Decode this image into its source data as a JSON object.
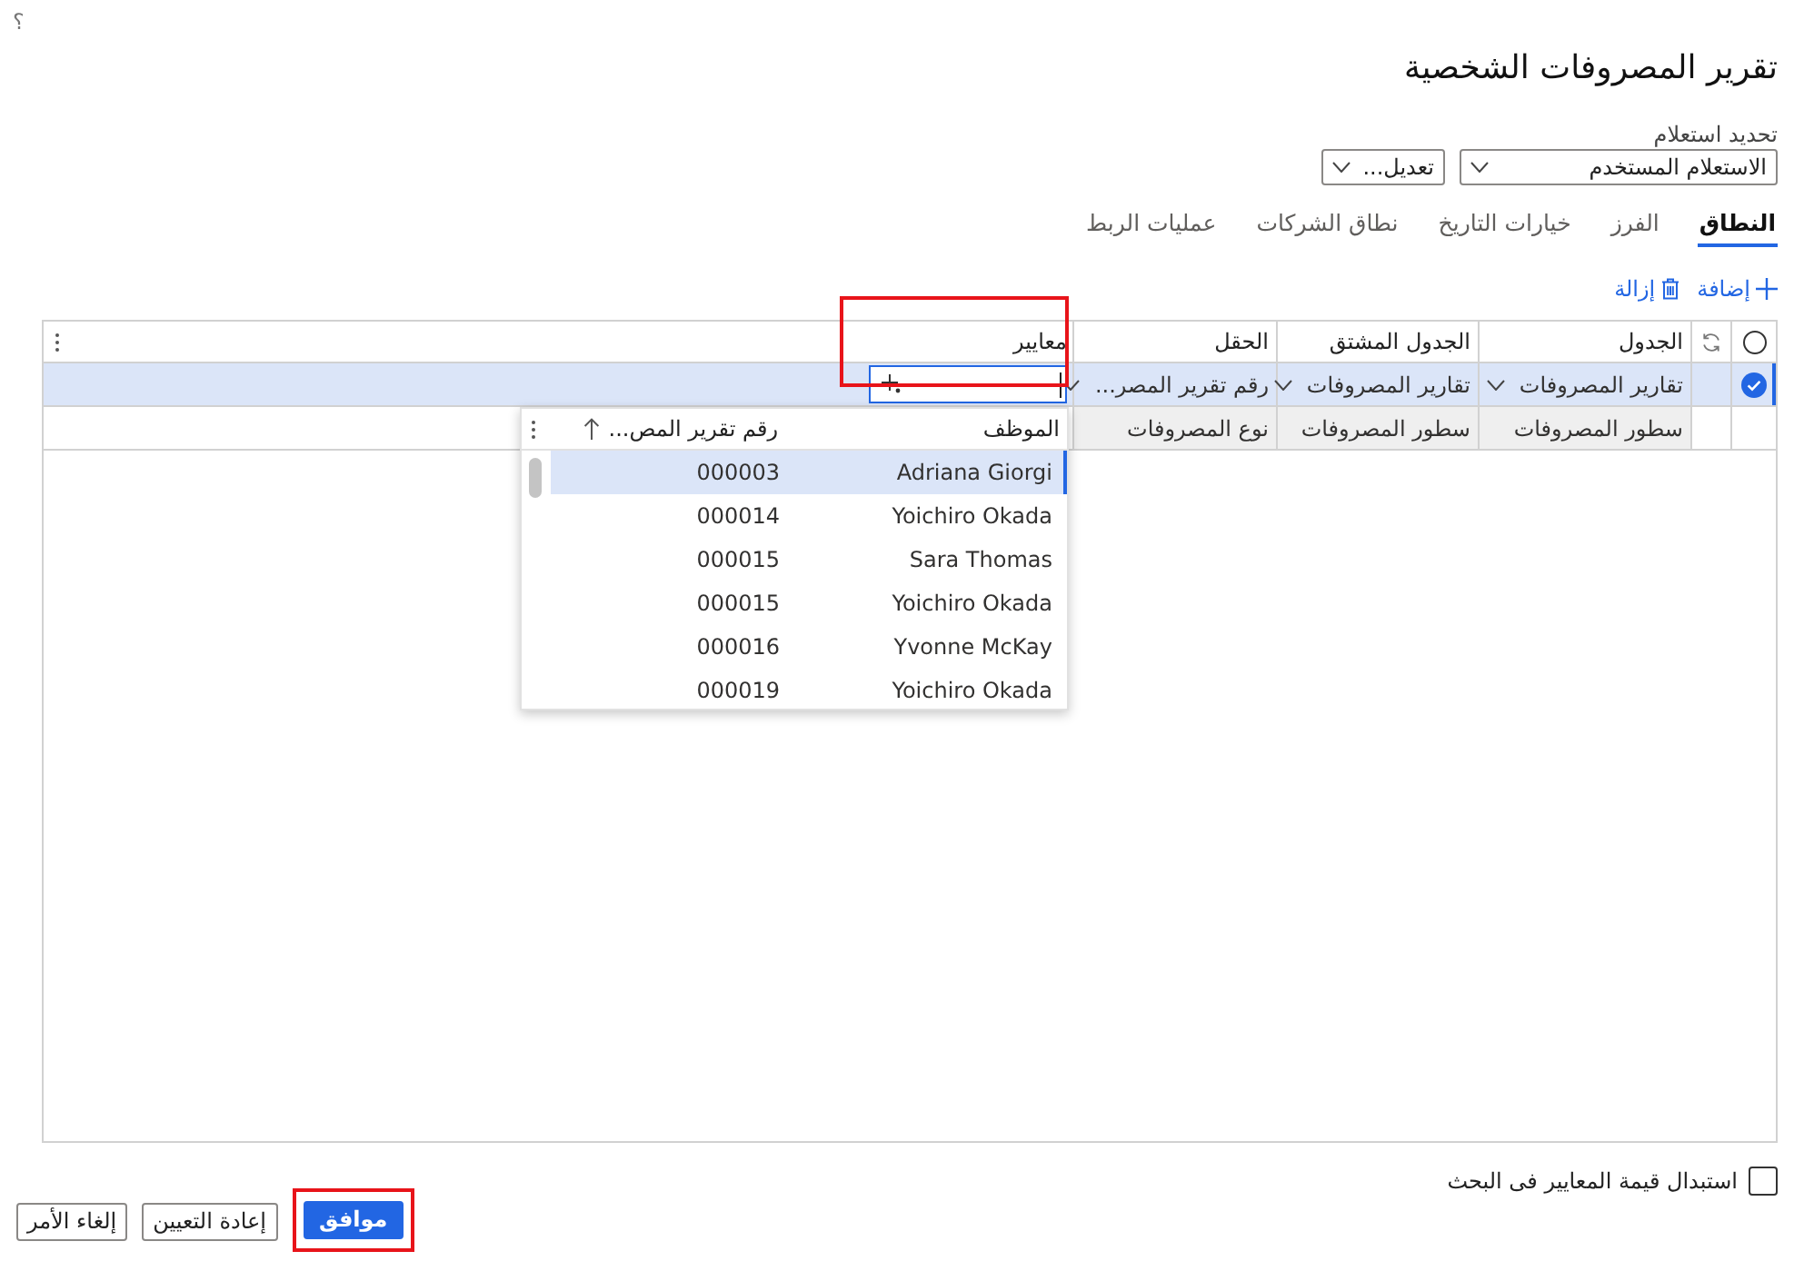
{
  "help": {
    "glyph": "؟"
  },
  "page_title": "تقرير المصروفات الشخصية",
  "query": {
    "label": "تحديد استعلام",
    "value": "الاستعلام المستخدم",
    "modify_button": "تعديل..."
  },
  "tabs": [
    {
      "label": "النطاق",
      "selected": true
    },
    {
      "label": "الفرز",
      "selected": false
    },
    {
      "label": "خيارات التاريخ",
      "selected": false
    },
    {
      "label": "نطاق الشركات",
      "selected": false
    },
    {
      "label": "عمليات الربط",
      "selected": false
    }
  ],
  "toolbar": {
    "add": "إضافة",
    "remove": "إزالة"
  },
  "grid": {
    "select_all_checked": false,
    "criteria_highlighted": true,
    "columns": [
      "الجدول",
      "الجدول المشتق",
      "الحقل",
      "معايير"
    ],
    "rows": [
      {
        "selected": true,
        "readonly": false,
        "cells": [
          "تقارير المصروفات",
          "تقارير المصروفات",
          "رقم تقرير المصر..."
        ]
      },
      {
        "selected": false,
        "readonly": true,
        "cells": [
          "سطور المصروفات",
          "سطور المصروفات",
          "نوع المصروفات"
        ]
      }
    ]
  },
  "lookup": {
    "columns": [
      "الموظف",
      "رقم تقرير المص..."
    ],
    "rows": [
      {
        "employee": "Adriana Giorgi",
        "report": "000003",
        "selected": true
      },
      {
        "employee": "Yoichiro Okada",
        "report": "000014",
        "selected": false
      },
      {
        "employee": "Sara Thomas",
        "report": "000015",
        "selected": false
      },
      {
        "employee": "Yoichiro Okada",
        "report": "000015",
        "selected": false
      },
      {
        "employee": "Yvonne McKay",
        "report": "000016",
        "selected": false
      },
      {
        "employee": "Yoichiro Okada",
        "report": "000019",
        "selected": false
      }
    ]
  },
  "replace_criteria": {
    "label": "استبدال قيمة المعايير فى البحث",
    "checked": false
  },
  "buttons": [
    {
      "label": "موافق",
      "kind": "primary",
      "highlighted": true
    },
    {
      "label": "إعادة التعيين",
      "kind": "secondary",
      "highlighted": false
    },
    {
      "label": "إلغاء الأمر",
      "kind": "secondary",
      "highlighted": false
    }
  ]
}
